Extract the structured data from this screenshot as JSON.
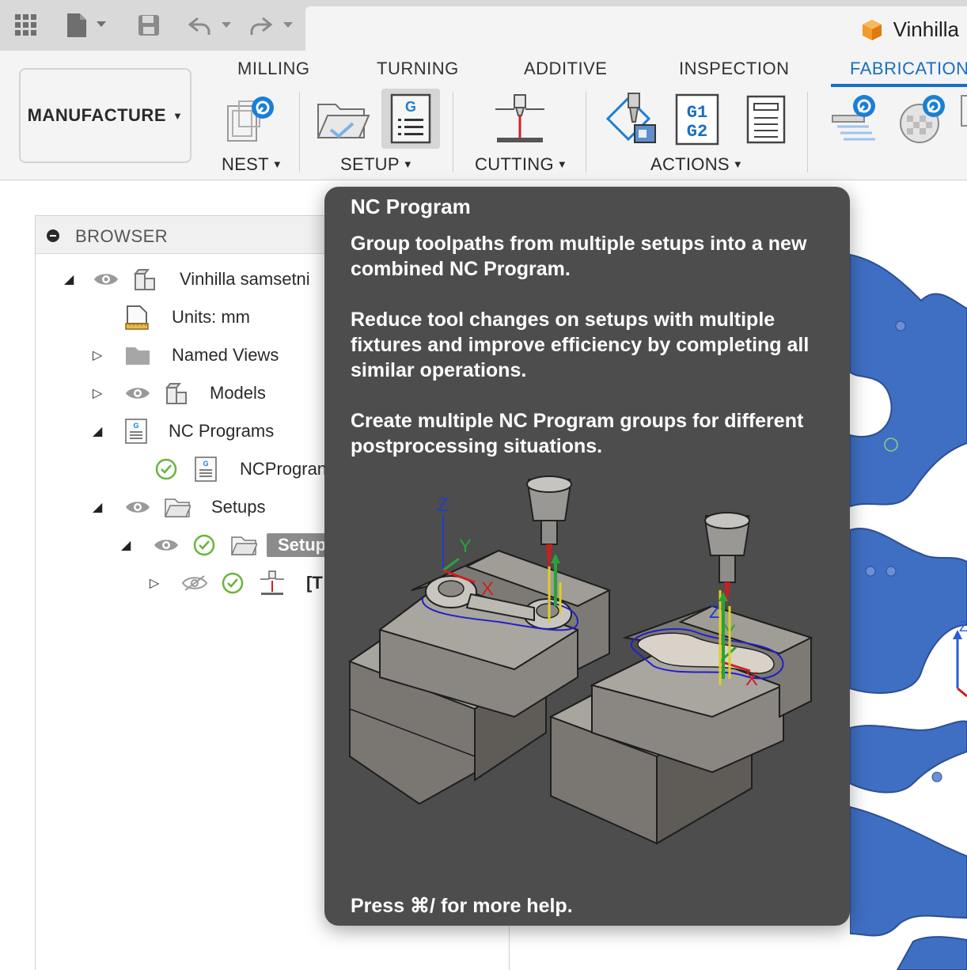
{
  "document": {
    "title": "Vinhilla"
  },
  "ribbon": {
    "workspace_label": "MANUFACTURE",
    "tabs": [
      "MILLING",
      "TURNING",
      "ADDITIVE",
      "INSPECTION",
      "FABRICATION"
    ],
    "active_tab": "FABRICATION",
    "groups": {
      "nest": "NEST",
      "setup": "SETUP",
      "cutting": "CUTTING",
      "actions": "ACTIONS"
    },
    "actions_g1": "G1",
    "actions_g2": "G2",
    "setup_g": "G",
    "accent_color": "#1a6fc0"
  },
  "browser": {
    "title": "BROWSER",
    "items": [
      {
        "label": "Vinhilla samsetni"
      },
      {
        "label": "Units: mm"
      },
      {
        "label": "Named Views"
      },
      {
        "label": "Models"
      },
      {
        "label": "NC Programs"
      },
      {
        "label": "NCProgran"
      },
      {
        "label": "Setups"
      },
      {
        "label": "Setup"
      },
      {
        "label": "[T"
      }
    ]
  },
  "tooltip": {
    "title": "NC Program",
    "paragraphs": [
      "Group toolpaths from multiple setups into a new combined NC Program.",
      "Reduce tool changes on setups with multiple fixtures and improve efficiency by completing all similar operations.",
      "Create multiple NC Program groups for different postprocessing situations."
    ],
    "footer": "Press ⌘/ for more help.",
    "axis_labels": {
      "x": "X",
      "y": "Y",
      "z": "Z"
    }
  }
}
